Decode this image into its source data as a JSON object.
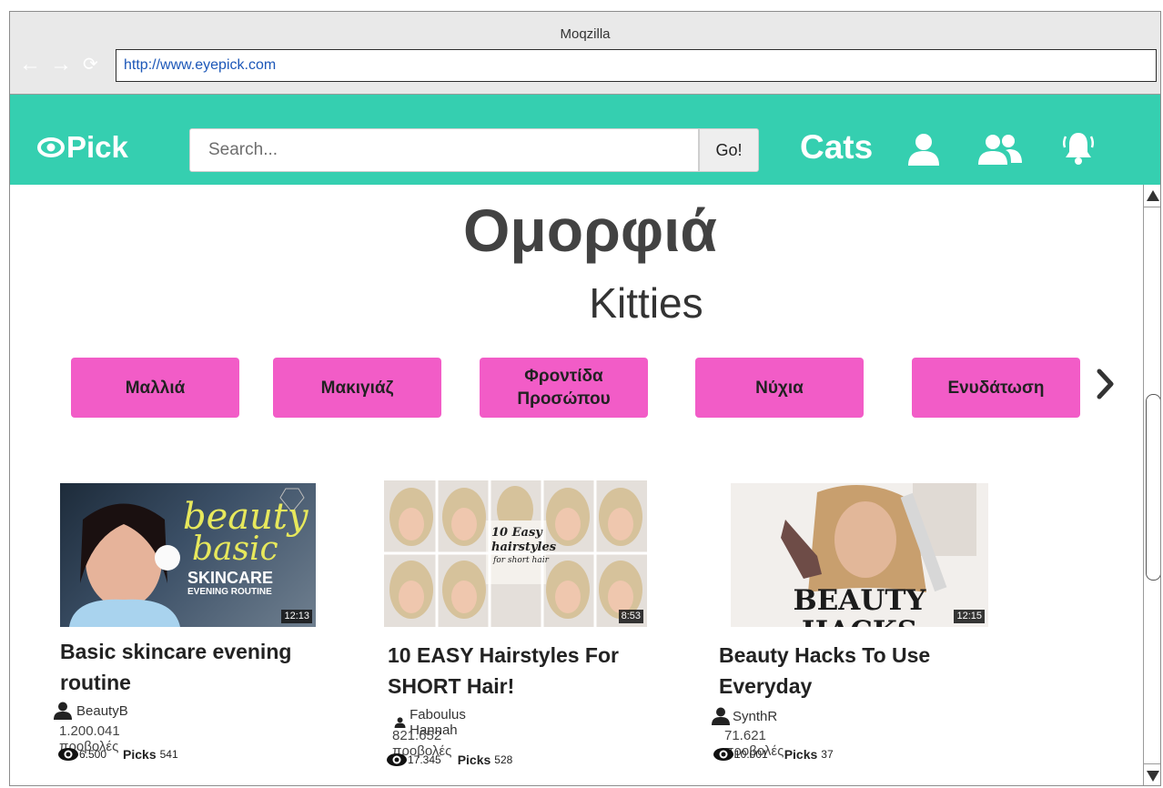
{
  "browser": {
    "title": "Moqzilla",
    "url": "http://www.eyepick.com"
  },
  "header": {
    "logo": "Pick",
    "search_placeholder": "Search...",
    "go_label": "Go!",
    "cats_label": "Cats"
  },
  "page": {
    "heading": "Ομορφιά",
    "subheading": "Kitties"
  },
  "categories": [
    {
      "label": "Μαλλιά"
    },
    {
      "label": "Μακιγιάζ"
    },
    {
      "label": "Φροντίδα Προσώπου"
    },
    {
      "label": "Νύχια"
    },
    {
      "label": "Ενυδάτωση"
    }
  ],
  "videos": [
    {
      "title": "Basic skincare  evening routine",
      "author": "BeautyB",
      "views": "1.200.041 προβολές",
      "watch_count": "6.500",
      "picks_label": "Picks",
      "picks": "541",
      "duration": "12:13",
      "thumb_text": [
        "beauty",
        "basic",
        "SKINCARE",
        "EVENING ROUTINE"
      ]
    },
    {
      "title": "10 EASY Hairstyles For SHORT Hair!",
      "author": "Faboulus Hannah",
      "views": "821.652 προβολές",
      "watch_count": "17.345",
      "picks_label": "Picks",
      "picks": "528",
      "duration": "8:53",
      "thumb_text": [
        "10 Easy",
        "hairstyles",
        "for short hair"
      ]
    },
    {
      "title": "Beauty Hacks To Use Everyday",
      "author": "SynthR",
      "views": "71.621 προβολές",
      "watch_count": "10.001",
      "picks_label": "Picks",
      "picks": "37",
      "duration": "12:15",
      "thumb_text": [
        "BEAUTY HACKS"
      ]
    }
  ],
  "colors": {
    "header": "#35cfb0",
    "category_button": "#f25cc7"
  }
}
